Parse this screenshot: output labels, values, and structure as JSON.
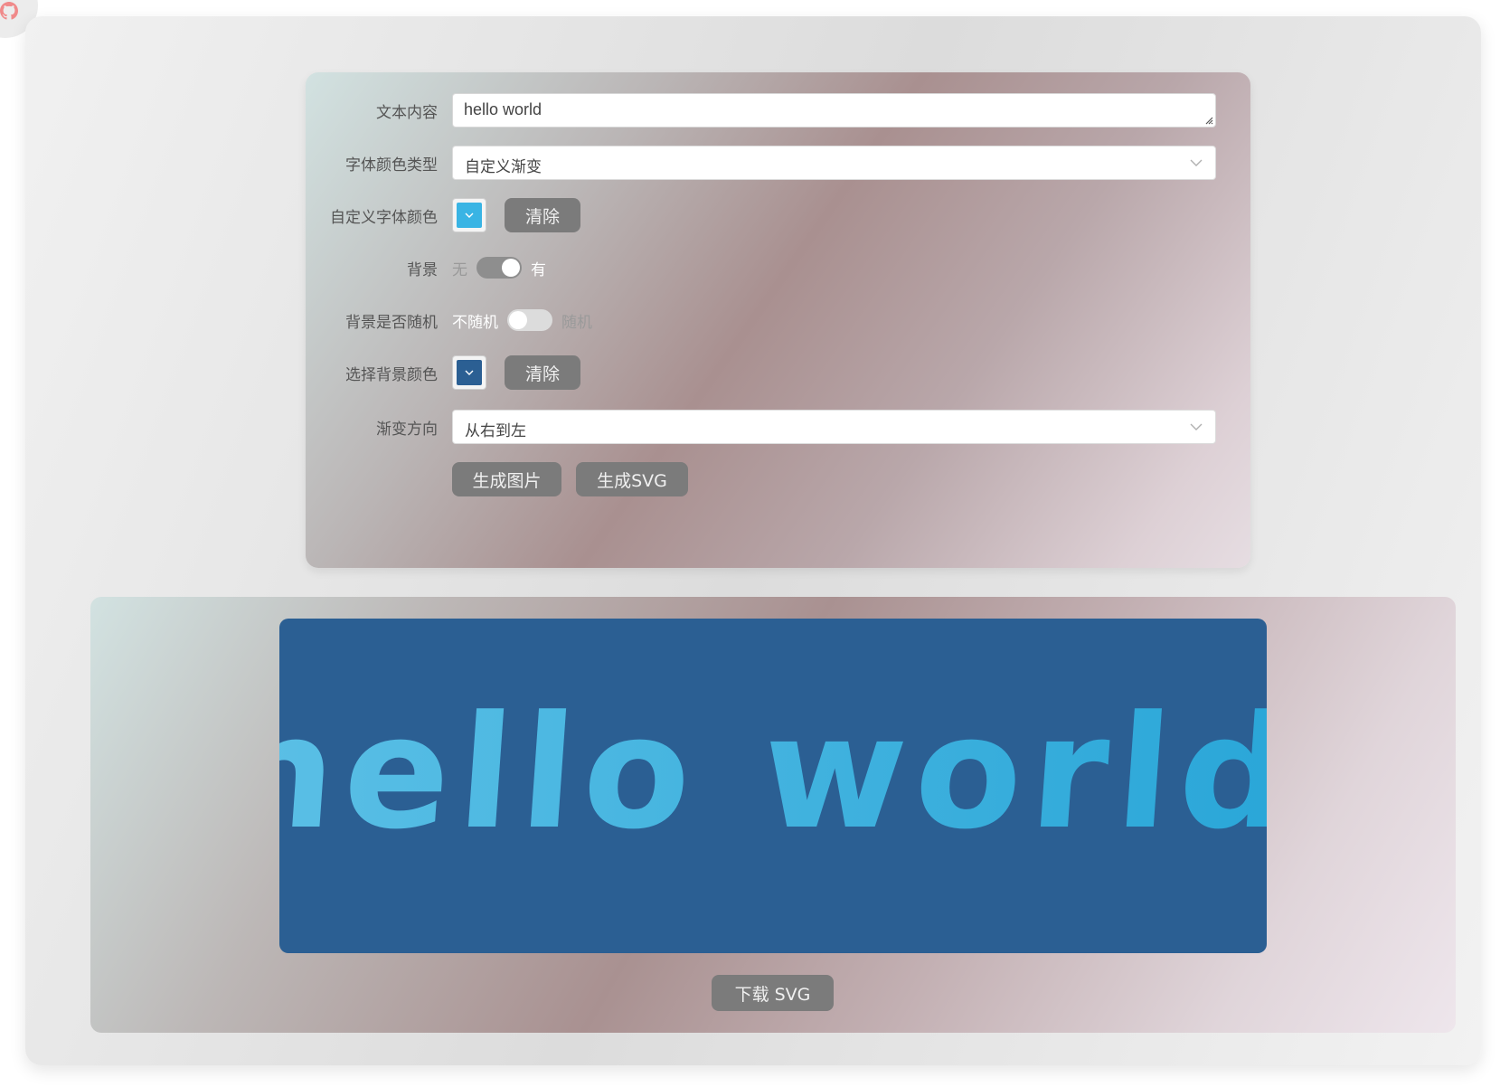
{
  "form": {
    "text_content": {
      "label": "文本内容",
      "value": "hello world"
    },
    "font_color_type": {
      "label": "字体颜色类型",
      "value": "自定义渐变"
    },
    "custom_font_color": {
      "label": "自定义字体颜色",
      "color": "#39b4e4",
      "clear_label": "清除"
    },
    "background": {
      "label": "背景",
      "off_text": "无",
      "on_text": "有",
      "enabled": true
    },
    "background_random": {
      "label": "背景是否随机",
      "off_text": "不随机",
      "on_text": "随机",
      "enabled": false
    },
    "background_color": {
      "label": "选择背景颜色",
      "color": "#2b5f93",
      "clear_label": "清除"
    },
    "gradient_direction": {
      "label": "渐变方向",
      "value": "从右到左"
    },
    "buttons": {
      "generate_image": "生成图片",
      "generate_svg": "生成SVG"
    }
  },
  "preview": {
    "text": "hello world",
    "background_color": "#2b5f93",
    "text_gradient": [
      "#29a6d8",
      "#5cc0e6"
    ],
    "download_label": "下载 SVG"
  },
  "colors": {
    "button_gray": "#7b7b7b",
    "switch_on": "#8e8e8e",
    "switch_off": "#dcdcdc"
  },
  "icons": {
    "corner": "github-icon",
    "select_arrow": "chevron-down-icon",
    "swatch_arrow": "chevron-down-icon"
  }
}
